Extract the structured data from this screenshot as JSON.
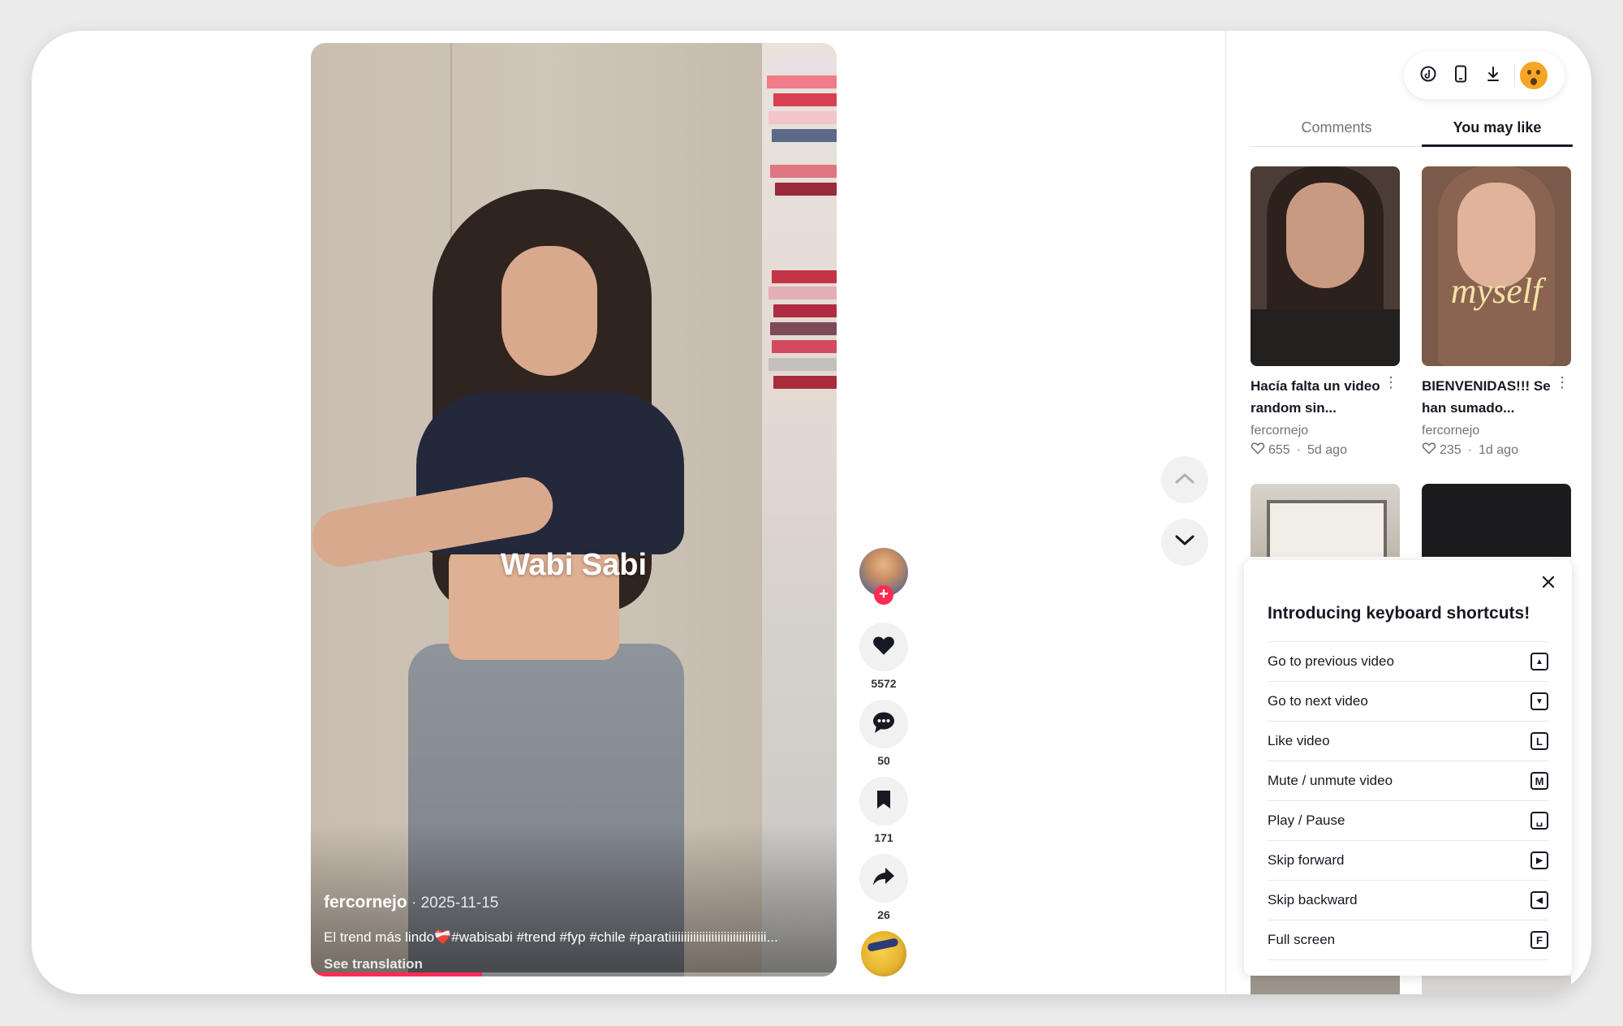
{
  "video": {
    "overlay_text": "Wabi Sabi",
    "author": "fercornejo",
    "date_sep": " · ",
    "date": "2025-11-15",
    "caption": "El trend más lindo❤️‍🩹#wabisabi #trend #fyp #chile #paratiiiiiiiiiiiiiiiiiiiiiiiiiiiiiiii...",
    "see_translation": "See translation",
    "progress": 0.325
  },
  "actions": {
    "likes": "5572",
    "comments": "50",
    "saves": "171",
    "shares": "26"
  },
  "sidebar": {
    "tabs": [
      {
        "label": "Comments",
        "active": false
      },
      {
        "label": "You may like",
        "active": true
      }
    ],
    "cards": [
      {
        "title": "Hacía falta un video random sin...",
        "author": "fercornejo",
        "likes": "655",
        "sep": "·",
        "ago": "5d ago"
      },
      {
        "title": "BIENVENIDAS!!! Se han sumado...",
        "author": "fercornejo",
        "likes": "235",
        "sep": "·",
        "ago": "1d ago",
        "overlay": "myself"
      }
    ]
  },
  "shortcuts": {
    "title": "Introducing keyboard shortcuts!",
    "items": [
      {
        "label": "Go to previous video",
        "key": "▲"
      },
      {
        "label": "Go to next video",
        "key": "▼"
      },
      {
        "label": "Like video",
        "key": "L"
      },
      {
        "label": "Mute / unmute video",
        "key": "M"
      },
      {
        "label": "Play / Pause",
        "key": "␣"
      },
      {
        "label": "Skip forward",
        "key": "▶"
      },
      {
        "label": "Skip backward",
        "key": "◀"
      },
      {
        "label": "Full screen",
        "key": "F"
      }
    ]
  },
  "colors": {
    "accent": "#fe2c55",
    "text": "#161823"
  }
}
